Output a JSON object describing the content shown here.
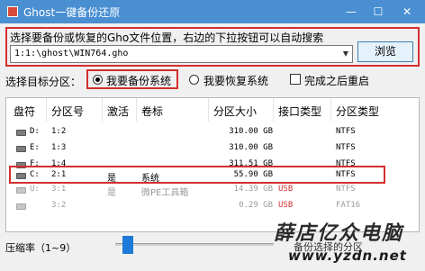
{
  "titlebar": {
    "title": "Ghost一键备份还原",
    "min_glyph": "—",
    "max_glyph": "☐",
    "close_glyph": "✕"
  },
  "source": {
    "prompt": "选择要备份或恢复的Gho文件位置，右边的下拉按钮可以自动搜索",
    "path_value": "1:1:\\ghost\\WIN764.gho",
    "dropdown_glyph": "▼",
    "browse_label": "浏览"
  },
  "options": {
    "target_label": "选择目标分区：",
    "backup_label": "我要备份系统",
    "restore_label": "我要恢复系统",
    "reboot_label": "完成之后重启",
    "backup_selected": true,
    "reboot_checked": false
  },
  "table": {
    "columns": [
      "盘符",
      "分区号",
      "激活",
      "卷标",
      "分区大小",
      "接口类型",
      "分区类型"
    ],
    "rows": [
      {
        "drive": "D:",
        "partition": "1:2",
        "active": "",
        "label": "",
        "size": "310.00 GB",
        "interface": "",
        "fs": "NTFS",
        "dim": false
      },
      {
        "drive": "E:",
        "partition": "1:3",
        "active": "",
        "label": "",
        "size": "310.00 GB",
        "interface": "",
        "fs": "NTFS",
        "dim": false
      },
      {
        "drive": "F:",
        "partition": "1:4",
        "active": "",
        "label": "",
        "size": "311.51 GB",
        "interface": "",
        "fs": "NTFS",
        "dim": false
      },
      {
        "drive": "C:",
        "partition": "2:1",
        "active": "是",
        "label": "系统",
        "size": "55.90 GB",
        "interface": "",
        "fs": "NTFS",
        "dim": false
      },
      {
        "drive": "U:",
        "partition": "3:1",
        "active": "是",
        "label": "微PE工具箱",
        "size": "14.39 GB",
        "interface": "USB",
        "fs": "NTFS",
        "dim": true
      },
      {
        "drive": "",
        "partition": "3:2",
        "active": "",
        "label": "",
        "size": "0.29 GB",
        "interface": "USB",
        "fs": "FAT16",
        "dim": true
      }
    ]
  },
  "footer": {
    "ratio_label": "压缩率（1~9）",
    "compression_level": 1,
    "status": "备份选择的分区"
  },
  "watermark": {
    "brand": "薛店亿众电脑",
    "url": "www.yzdn.net"
  },
  "colors": {
    "titlebar": "#4a8fd2",
    "highlight": "#d32f2f",
    "usb": "#d32f2f",
    "slider": "#1e7ad8"
  }
}
